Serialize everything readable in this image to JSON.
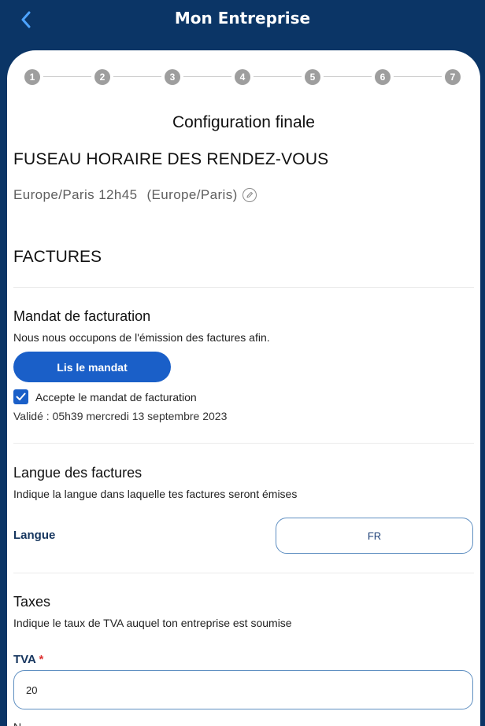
{
  "header": {
    "title": "Mon Entreprise",
    "back_icon": "chevron-left-icon"
  },
  "stepper": {
    "steps": [
      "1",
      "2",
      "3",
      "4",
      "5",
      "6",
      "7"
    ]
  },
  "page": {
    "title": "Configuration finale"
  },
  "timezone": {
    "heading": "FUSEAU HORAIRE DES RENDEZ-VOUS",
    "value": "Europe/Paris 12h45",
    "zone": "(Europe/Paris)",
    "edit_icon": "edit-pencil-icon"
  },
  "invoices": {
    "heading": "FACTURES",
    "mandate": {
      "title": "Mandat de facturation",
      "description": "Nous nous occupons de l'émission des factures afin.",
      "button_label": "Lis le mandat",
      "checkbox_label": "Accepte le mandat de facturation",
      "checked": true,
      "validated_text": "Validé : 05h39 mercredi 13 septembre 2023"
    },
    "language": {
      "title": "Langue des factures",
      "description": "Indique la langue dans laquelle tes factures seront émises",
      "field_label": "Langue",
      "selected": "FR"
    },
    "taxes": {
      "title": "Taxes",
      "description": "Indique le taux de TVA auquel ton entreprise est soumise",
      "field_label": "TVA",
      "required_mark": "*",
      "value": "20"
    }
  },
  "colors": {
    "header_bg": "#0b3566",
    "primary": "#1a5fc8",
    "step_circle": "#9e9e9e",
    "label_blue": "#15355e"
  }
}
